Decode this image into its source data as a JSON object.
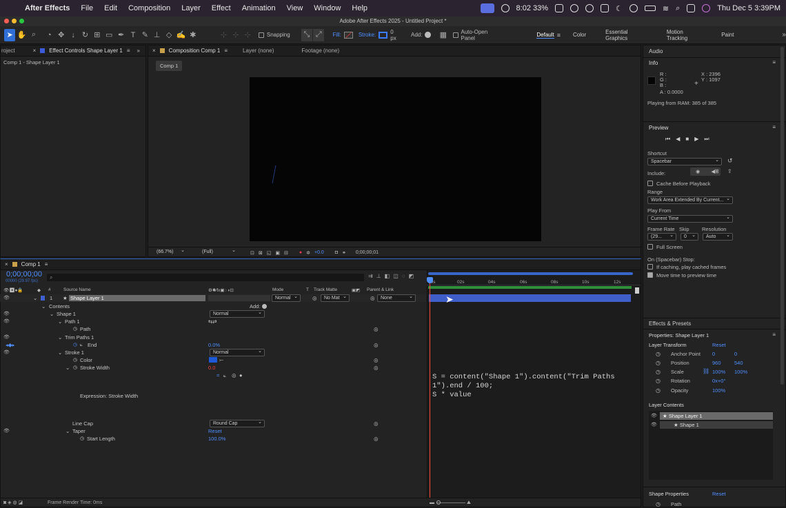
{
  "menubar": {
    "app_name": "After Effects",
    "items": [
      "File",
      "Edit",
      "Composition",
      "Layer",
      "Effect",
      "Animation",
      "View",
      "Window",
      "Help"
    ],
    "time_battery": "8:02 33%",
    "datetime": "Thu Dec 5  3:39PM"
  },
  "window_title": "Adobe After Effects 2025 - Untitled Project *",
  "toolbar": {
    "snapping_label": "Snapping",
    "fill_label": "Fill:",
    "stroke_label": "Stroke:",
    "stroke_value": "0 px",
    "add_label": "Add:",
    "auto_open_label": "Auto-Open Panel",
    "workspaces": [
      "Default",
      "Color",
      "Essential Graphics",
      "Motion Tracking",
      "Paint"
    ]
  },
  "left_panel": {
    "project_tab": "roject",
    "effect_controls_tab": "Effect Controls Shape Layer 1",
    "breadcrumb": "Comp 1 - Shape Layer 1"
  },
  "viewer": {
    "comp_tab": "Composition Comp 1",
    "layer_tab": "Layer (none)",
    "footage_tab": "Footage (none)",
    "comp_button": "Comp 1",
    "zoom": "(66.7%)",
    "resolution": "(Full)",
    "exposure": "+0.0",
    "timecode": "0;00;00;01"
  },
  "timeline": {
    "comp_name": "Comp 1",
    "current_time": "0;00;00;00",
    "fps_info": "00000 (29.97 fps)",
    "col_source_name": "Source Name",
    "col_mode": "Mode",
    "col_t": "T",
    "col_track_matte": "Track Matte",
    "col_parent": "Parent & Link",
    "layer_num": "1",
    "layer_name": "Shape Layer 1",
    "layer_mode": "Normal",
    "layer_matte": "No Mat",
    "layer_parent": "None",
    "add_label": "Add:",
    "rows": {
      "contents": "Contents",
      "shape1": "Shape 1",
      "shape1_mode": "Normal",
      "path1": "Path 1",
      "path": "Path",
      "trim": "Trim Paths 1",
      "end": "End",
      "end_val": "0.0%",
      "stroke1": "Stroke 1",
      "stroke1_mode": "Normal",
      "color": "Color",
      "stroke_width": "Stroke Width",
      "stroke_width_val": "0.0",
      "expression_label": "Expression: Stroke Width",
      "line_cap": "Line Cap",
      "line_cap_val": "Round Cap",
      "taper": "Taper",
      "taper_reset": "Reset",
      "start_length": "Start Length",
      "start_length_val": "100.0%"
    },
    "ruler": [
      "00s",
      "02s",
      "04s",
      "06s",
      "08s",
      "10s",
      "12s"
    ],
    "expression_lines": [
      "S = content(\"Shape 1\").content(\"Trim Paths",
      "1\").end / 100;",
      "S * value"
    ],
    "frame_render": "Frame Render Time:  0ms"
  },
  "right_panel": {
    "audio": "Audio",
    "info": "Info",
    "r": "R :",
    "g": "G :",
    "b": "B :",
    "a": "A :  0.0000",
    "x": "X : 2396",
    "y": "Y : 1097",
    "playing": "Playing from RAM: 385 of 385",
    "preview": "Preview",
    "shortcut_label": "Shortcut",
    "shortcut_val": "Spacebar",
    "include_label": "Include:",
    "cache_label": "Cache Before Playback",
    "range_label": "Range",
    "range_val": "Work Area Extended By Current...",
    "play_from_label": "Play From",
    "play_from_val": "Current Time",
    "frame_rate_label": "Frame Rate",
    "skip_label": "Skip",
    "resolution_label": "Resolution",
    "frame_rate_val": "(29...",
    "skip_val": "0",
    "resolution_val": "Auto",
    "full_screen": "Full Screen",
    "on_stop": "On (Spacebar) Stop:",
    "if_caching": "If caching, play cached frames",
    "move_time": "Move time to preview time",
    "effects_presets": "Effects & Presets",
    "properties_title": "Properties: Shape Layer 1",
    "layer_transform": "Layer Transform",
    "reset": "Reset",
    "anchor_label": "Anchor Point",
    "anchor_x": "0",
    "anchor_y": "0",
    "position_label": "Position",
    "position_x": "960",
    "position_y": "540",
    "scale_label": "Scale",
    "scale_x": "100%",
    "scale_y": "100%",
    "rotation_label": "Rotation",
    "rotation_val": "0x+0°",
    "opacity_label": "Opacity",
    "opacity_val": "100%",
    "layer_contents": "Layer Contents",
    "lc_layer": "Shape Layer 1",
    "lc_shape": "Shape 1",
    "shape_props": "Shape Properties",
    "shape_reset": "Reset",
    "path_label": "Path"
  }
}
